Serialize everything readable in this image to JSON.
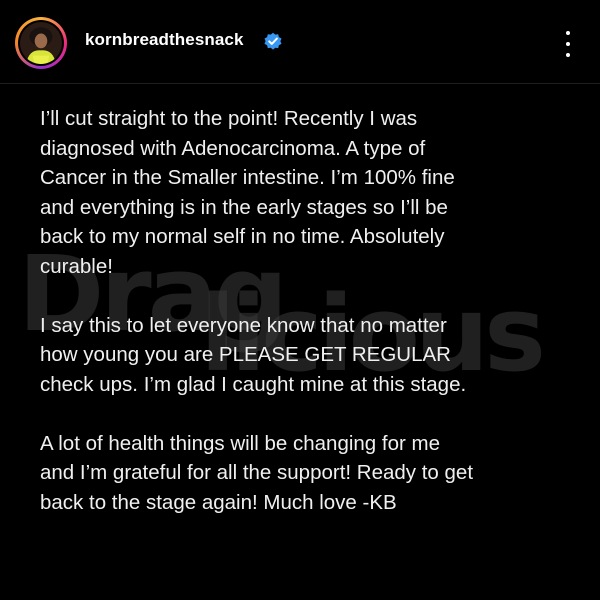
{
  "post": {
    "username": "kornbreadthesnack",
    "verified": true,
    "avatar_icon": "profile-photo-icon",
    "more_icon": "more-options-icon",
    "paragraphs": [
      "I’ll cut straight to the point! Recently I was\ndiagnosed with Adenocarcinoma. A type of\nCancer in the Smaller intestine. I’m 100% fine\nand everything is in the early stages so I’ll be\nback to my normal self in no time. Absolutely\ncurable!",
      "I say this to let everyone know that no matter\nhow young you are PLEASE GET REGULAR\ncheck ups. I’m glad I caught mine at this stage.",
      "A lot of health things will be changing for me\nand I’m grateful for all the support! Ready to get\nback to the stage again! Much love -KB"
    ]
  },
  "watermark": {
    "line1": "Drag",
    "line2": "licious"
  },
  "colors": {
    "background": "#000000",
    "text": "#f0f0f0",
    "verified_badge": "#3897f0",
    "watermark": "#3a3a3a"
  }
}
